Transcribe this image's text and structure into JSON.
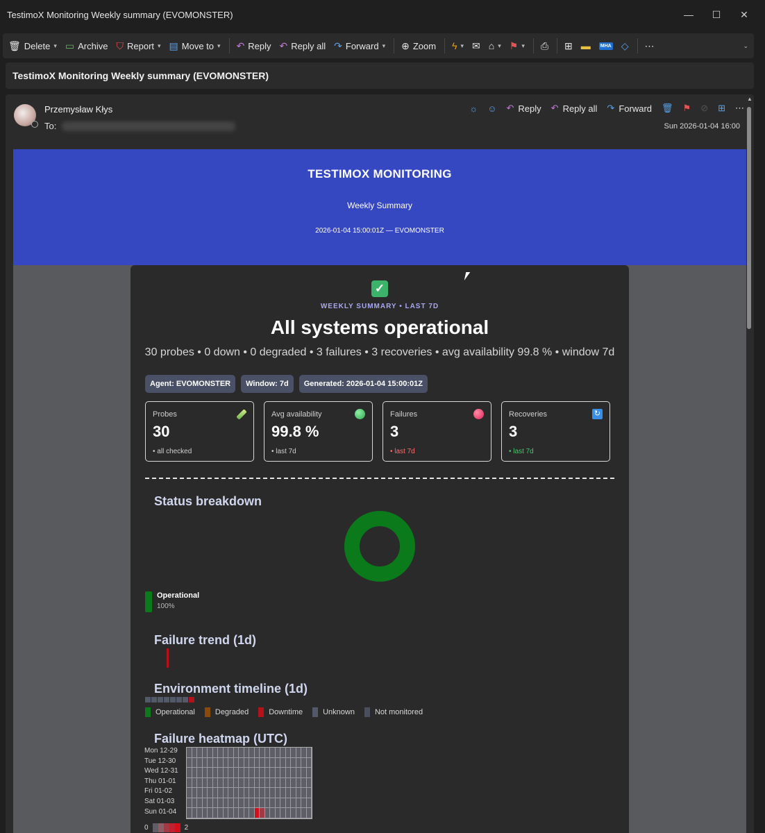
{
  "window": {
    "title": "TestimoX Monitoring Weekly summary (EVOMONSTER)"
  },
  "toolbar": {
    "delete": "Delete",
    "archive": "Archive",
    "report": "Report",
    "move_to": "Move to",
    "reply": "Reply",
    "reply_all": "Reply all",
    "forward": "Forward",
    "zoom": "Zoom",
    "mha": "MHA"
  },
  "subject": "TestimoX Monitoring Weekly summary (EVOMONSTER)",
  "message": {
    "sender": "Przemysław Kłys",
    "to_label": "To:",
    "date": "Sun 2026-01-04 16:00",
    "actions": {
      "reply": "Reply",
      "reply_all": "Reply all",
      "forward": "Forward"
    }
  },
  "email": {
    "banner": {
      "title": "TESTIMOX MONITORING",
      "subtitle": "Weekly Summary",
      "meta": "2026-01-04 15:00:01Z — EVOMONSTER"
    },
    "kicker": "WEEKLY SUMMARY • LAST 7D",
    "headline": "All systems operational",
    "summary": "30 probes • 0 down • 0 degraded • 3 failures • 3 recoveries • avg availability 99.8 % • window 7d",
    "pills": [
      "Agent: EVOMONSTER",
      "Window: 7d",
      "Generated: 2026-01-04 15:00:01Z"
    ],
    "metrics": [
      {
        "label": "Probes",
        "value": "30",
        "sub": "• all checked",
        "icon": "test-tube-icon",
        "color": "#cfcfcf"
      },
      {
        "label": "Avg availability",
        "value": "99.8 %",
        "sub": "• last 7d",
        "icon": "green-circle-icon",
        "color": "#cfcfcf"
      },
      {
        "label": "Failures",
        "value": "3",
        "sub": "• last 7d",
        "icon": "red-circle-icon",
        "color": "#ff6b6b"
      },
      {
        "label": "Recoveries",
        "value": "3",
        "sub": "• last 7d",
        "icon": "refresh-icon",
        "color": "#49c46a"
      }
    ],
    "status_breakdown": {
      "title": "Status breakdown",
      "legend_label": "Operational",
      "legend_pct": "100%",
      "operational_fraction": 1.0,
      "color": "#0a7a1a"
    },
    "failure_trend": {
      "title": "Failure trend (1d)",
      "values": [
        3
      ]
    },
    "env_timeline": {
      "title": "Environment timeline (1d)",
      "cells": [
        "unknown",
        "unknown",
        "unknown",
        "unknown",
        "unknown",
        "unknown",
        "unknown",
        "downtime"
      ],
      "legend": [
        {
          "label": "Operational",
          "color": "#0a7a1a"
        },
        {
          "label": "Degraded",
          "color": "#8a4a0a"
        },
        {
          "label": "Downtime",
          "color": "#b3121a"
        },
        {
          "label": "Unknown",
          "color": "#54596a"
        },
        {
          "label": "Not monitored",
          "color": "#4a4f5e"
        }
      ]
    },
    "heatmap": {
      "title": "Failure heatmap (UTC)",
      "rows": [
        "Mon 12-29",
        "Tue 12-30",
        "Wed 12-31",
        "Thu 01-01",
        "Fri 01-02",
        "Sat 01-03",
        "Sun 01-04"
      ],
      "hours": 24,
      "hot_cells": [
        {
          "row": 6,
          "col": 13,
          "count": 2
        },
        {
          "row": 6,
          "col": 14,
          "count": 1
        }
      ],
      "scale_min": "0",
      "scale_max": "2"
    }
  }
}
